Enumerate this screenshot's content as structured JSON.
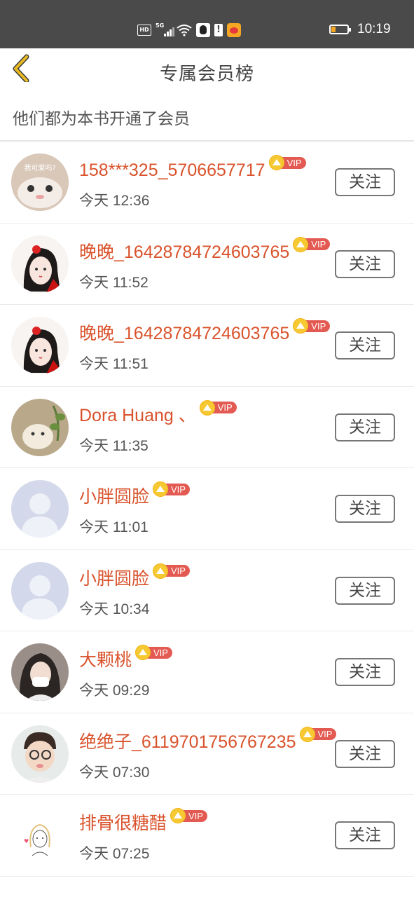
{
  "status_bar": {
    "time": "10:19",
    "icons": [
      "hd-icon",
      "5g-signal-icon",
      "wifi-icon",
      "qq-icon",
      "alert-icon",
      "weibo-icon",
      "battery-icon"
    ],
    "battery_color": "#f5a623"
  },
  "header": {
    "title": "专属会员榜",
    "back_icon": "chevron-left-icon",
    "back_color": "#e8b923"
  },
  "subtitle": "他们都为本书开通了会员",
  "colors": {
    "nickname": "#d9532c",
    "vip_badge": "#e35a52",
    "vip_crown": "#f6c933"
  },
  "vip_label": "VIP",
  "follow_label": "关注",
  "members": [
    {
      "name": "158***325_5706657717",
      "time": "今天 12:36",
      "avatar": "cat-photo"
    },
    {
      "name": "晚晚_16428784724603765",
      "time": "今天 11:52",
      "avatar": "illustrated-girl"
    },
    {
      "name": "晚晚_16428784724603765",
      "time": "今天 11:51",
      "avatar": "illustrated-girl"
    },
    {
      "name": "Dora Huang 、",
      "time": "今天 11:35",
      "avatar": "cat-with-plant"
    },
    {
      "name": "小胖圆脸",
      "time": "今天 11:01",
      "avatar": "default-person"
    },
    {
      "name": "小胖圆脸",
      "time": "今天 10:34",
      "avatar": "default-person"
    },
    {
      "name": "大颗桃",
      "time": "今天 09:29",
      "avatar": "girl-photo"
    },
    {
      "name": "绝绝子_6119701756767235",
      "time": "今天 07:30",
      "avatar": "boy-glasses"
    },
    {
      "name": "排骨很糖醋",
      "time": "今天 07:25",
      "avatar": "sketch-girl"
    }
  ]
}
